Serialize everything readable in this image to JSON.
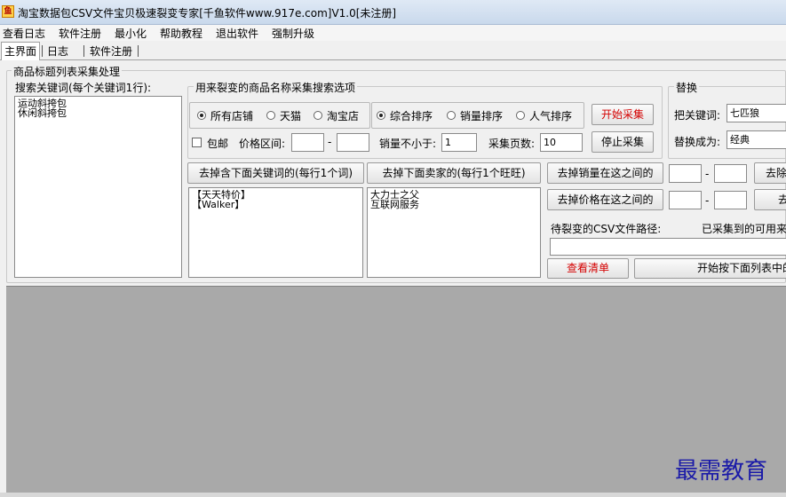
{
  "window": {
    "title": "淘宝数据包CSV文件宝贝极速裂变专家[千鱼软件www.917e.com]V1.0[未注册]",
    "icon_label": "鱼"
  },
  "menu": [
    "查看日志",
    "软件注册",
    "最小化",
    "帮助教程",
    "退出软件",
    "强制升级"
  ],
  "tabs": [
    {
      "label": "主界面",
      "active": true
    },
    {
      "label": "日志",
      "active": false
    },
    {
      "label": "软件注册",
      "active": false
    }
  ],
  "main_group": {
    "title": "商品标题列表采集处理",
    "keywords_label": "搜索关键词(每个关键词1行):",
    "keywords": [
      "运动斜挎包",
      "休闲斜挎包"
    ]
  },
  "options_group": {
    "title": "用来裂变的商品名称采集搜索选项",
    "shop_radios": [
      {
        "label": "所有店铺",
        "checked": true
      },
      {
        "label": "天猫",
        "checked": false
      },
      {
        "label": "淘宝店",
        "checked": false
      }
    ],
    "sort_radios": [
      {
        "label": "综合排序",
        "checked": true
      },
      {
        "label": "销量排序",
        "checked": false
      },
      {
        "label": "人气排序",
        "checked": false
      }
    ],
    "free_shipping_label": "包邮",
    "price_range_label": "价格区间:",
    "price_min": "",
    "price_max": "",
    "range_dash": "-",
    "min_sales_label": "销量不小于:",
    "min_sales_value": "1",
    "pages_label": "采集页数:",
    "pages_value": "10",
    "start_button": "开始采集",
    "stop_button": "停止采集"
  },
  "replace_group": {
    "title": "替换",
    "key_label": "把关键词:",
    "key_value": "七匹狼",
    "replace_label": "替换成为:",
    "replace_value": "经典"
  },
  "filters": {
    "remove_keywords_button": "去掉含下面关键词的(每行1个词)",
    "remove_keywords_list": [
      "【天天特价】",
      "【Walker】"
    ],
    "remove_sellers_button": "去掉下面卖家的(每行1个旺旺)",
    "remove_sellers_list": [
      "大力士之父",
      "互联网服务"
    ],
    "remove_sales_button": "去掉销量在这之间的",
    "remove_price_button": "去掉价格在这之间的",
    "range_dash": "-",
    "cut_button_1": "去除",
    "cut_button_2": "去"
  },
  "csv": {
    "path_label": "待裂变的CSV文件路径:",
    "collected_label": "已采集到的可用来",
    "path_value": "",
    "view_list_button": "查看清单",
    "start_split_button": "开始按下面列表中的"
  },
  "watermark": "最需教育",
  "colors": {
    "accent_red": "#d40000",
    "grid_bg": "#a9a9a9",
    "watermark": "#1a1aa8"
  }
}
